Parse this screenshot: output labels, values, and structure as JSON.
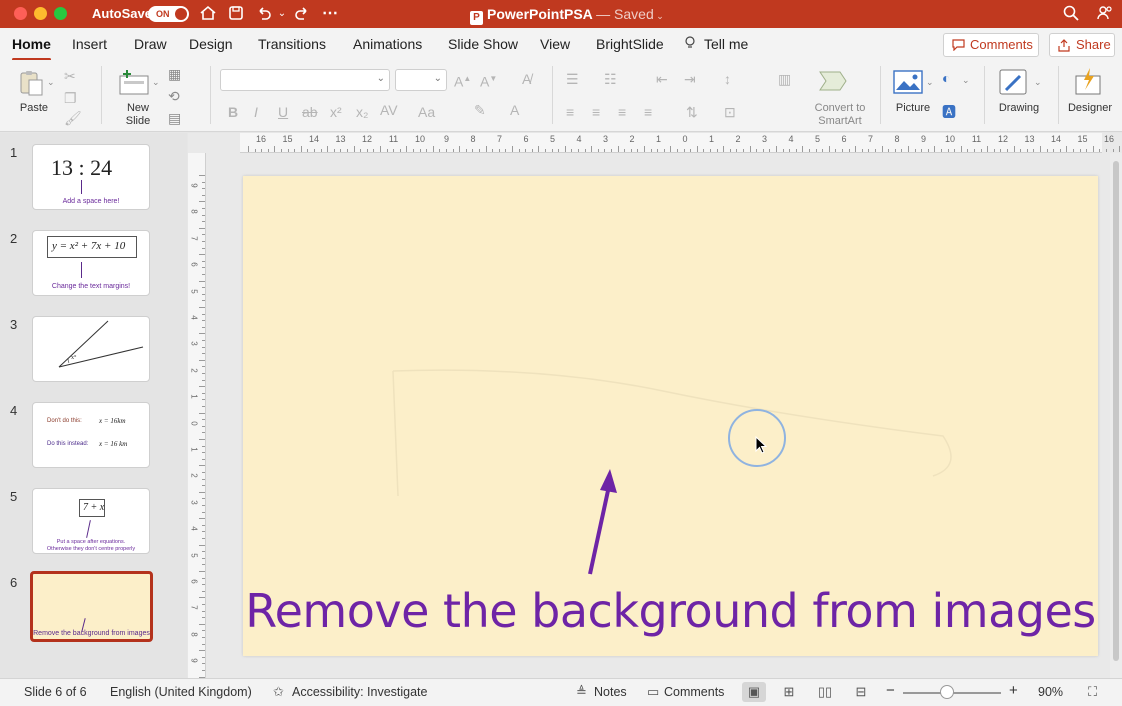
{
  "titlebar": {
    "autosave_label": "AutoSave",
    "autosave_state": "ON",
    "doc_name": "PowerPointPSA",
    "doc_status": "— Saved",
    "app_logo": "P",
    "icons": [
      "home-icon",
      "save-icon",
      "undo-icon",
      "redo-icon",
      "more-icon",
      "search-icon",
      "share-people-icon"
    ]
  },
  "tabs": {
    "items": [
      "Home",
      "Insert",
      "Draw",
      "Design",
      "Transitions",
      "Animations",
      "Slide Show",
      "View",
      "BrightSlide",
      "Tell me"
    ],
    "active": "Home",
    "comments_label": "Comments",
    "share_label": "Share"
  },
  "ribbon": {
    "paste_label": "Paste",
    "new_slide_label_1": "New",
    "new_slide_label_2": "Slide",
    "convert_label_1": "Convert to",
    "convert_label_2": "SmartArt",
    "picture_label": "Picture",
    "drawing_label": "Drawing",
    "designer_label": "Designer",
    "font_style_buttons": [
      "B",
      "I",
      "U",
      "ab",
      "x²",
      "x₂"
    ]
  },
  "slides": [
    {
      "number": "1",
      "main_text": "13 : 24",
      "caption": "Add a space here!"
    },
    {
      "number": "2",
      "main_text": "y = x² + 7x + 10",
      "caption": "Change the text margins!"
    },
    {
      "number": "3",
      "main_text": "x°",
      "caption": ""
    },
    {
      "number": "4",
      "line1_label": "Don't do this:",
      "line1_value": "x = 16km",
      "line2_label": "Do this instead:",
      "line2_value": "x = 16 km"
    },
    {
      "number": "5",
      "main_text": "7 + x",
      "caption": "Put a space after equations.",
      "caption2": "Otherwise they don't centre properly"
    },
    {
      "number": "6",
      "caption": "Remove the background from images"
    }
  ],
  "current_slide": {
    "caption": "Remove the background from images",
    "background": "#fcefc9",
    "caption_color": "#6e24a6"
  },
  "ruler_h_numbers": [
    "16",
    "15",
    "14",
    "13",
    "12",
    "11",
    "10",
    "9",
    "8",
    "7",
    "6",
    "5",
    "4",
    "3",
    "2",
    "1",
    "0",
    "1",
    "2",
    "3",
    "4",
    "5",
    "6",
    "7",
    "8",
    "9",
    "10",
    "11",
    "12",
    "13",
    "14",
    "15",
    "16"
  ],
  "ruler_v_numbers": [
    "9",
    "8",
    "7",
    "6",
    "5",
    "4",
    "3",
    "2",
    "1",
    "0",
    "1",
    "2",
    "3",
    "4",
    "5",
    "6",
    "7",
    "8",
    "9"
  ],
  "status": {
    "slide_indicator": "Slide 6 of 6",
    "language": "English (United Kingdom)",
    "accessibility": "Accessibility: Investigate",
    "notes_label": "Notes",
    "comments_label": "Comments",
    "zoom_minus": "−",
    "zoom_plus": "+",
    "zoom_value": "90%",
    "zoom_level_percent": 90
  },
  "colors": {
    "accent": "#c0391f",
    "selected_slide_border": "#b4321c"
  }
}
